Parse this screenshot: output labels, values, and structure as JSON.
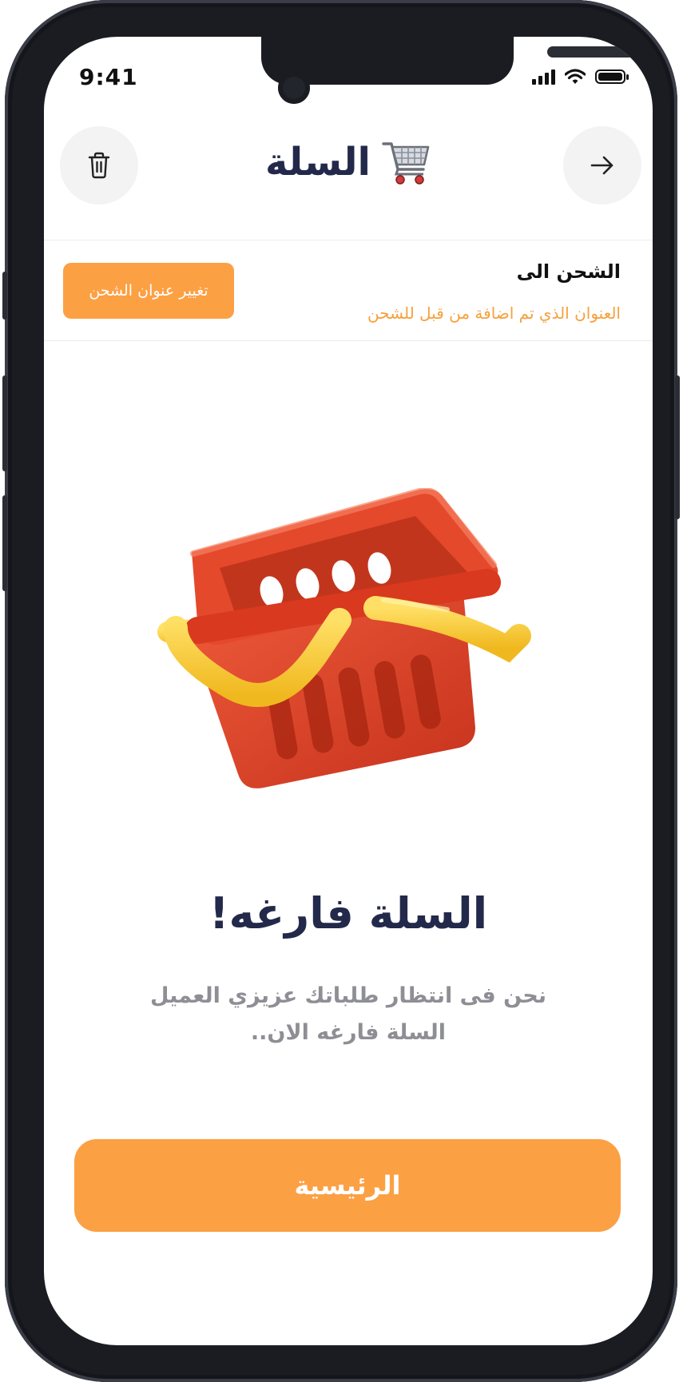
{
  "status_bar": {
    "time": "9:41"
  },
  "header": {
    "title": "السلة",
    "cart_icon": "shopping-cart-icon",
    "back_icon": "arrow-right-icon",
    "delete_icon": "trash-icon"
  },
  "shipping": {
    "label": "الشحن الى",
    "address_text": "العنوان الذي تم اضافة من قبل للشحن",
    "change_button": "تغيير عنوان الشحن"
  },
  "empty_state": {
    "illustration": "empty-basket-illustration",
    "title": "السلة فارغه!",
    "message_line1": "نحن فى انتظار طلباتك عزيزي العميل",
    "message_line2": "السلة فارغه الان.."
  },
  "home_button": "الرئيسية",
  "colors": {
    "accent": "#fca044",
    "address": "#f6a03c",
    "title": "#23294a",
    "muted": "#8e8e95",
    "basket": "#e2452b",
    "handle": "#f9c93a"
  }
}
